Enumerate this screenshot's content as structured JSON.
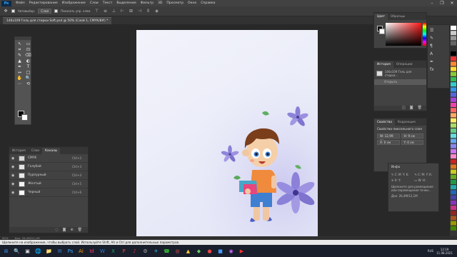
{
  "menubar": {
    "logo": "Ps",
    "items": [
      "Файл",
      "Редактирование",
      "Изображение",
      "Слои",
      "Текст",
      "Выделение",
      "Фильтр",
      "3D",
      "Просмотр",
      "Окно",
      "Справка"
    ],
    "window_buttons": [
      "–",
      "❐",
      "✕"
    ]
  },
  "options": {
    "autoselect_label": "Автовыбор:",
    "autoselect_value": "Слой",
    "transform_label": "Показать упр. элем."
  },
  "document": {
    "tab_title": "146х109 Гель для стирки Soft.psd @ 50% (Слой 1, CMYK/8#) *",
    "zoom": "50%",
    "doc_info": "Док: 26,4M/12,1M"
  },
  "tools": [
    "↖",
    "▭",
    "⌗",
    "⊡",
    "✎",
    "⌫",
    "▲",
    "◐",
    "✒",
    "T",
    "↔",
    "□",
    "✋",
    "🔍",
    "⋯",
    "⟲"
  ],
  "layers_panel": {
    "tabs": [
      "История",
      "Слои",
      "Каналы"
    ],
    "active_tab": "Каналы",
    "rows": [
      {
        "name": "CMYK",
        "shortcut": "Ctrl+2",
        "color": "#d8d8d8"
      },
      {
        "name": "Голубой",
        "shortcut": "Ctrl+3",
        "color": "#e4e4e4"
      },
      {
        "name": "Пурпурный",
        "shortcut": "Ctrl+4",
        "color": "#eaeaea"
      },
      {
        "name": "Желтый",
        "shortcut": "Ctrl+5",
        "color": "#f2f2f2"
      },
      {
        "name": "Черный",
        "shortcut": "Ctrl+6",
        "color": "#fafafa"
      }
    ]
  },
  "color_panel": {
    "tabs": [
      "Цвет",
      "Образцы"
    ]
  },
  "history_panel": {
    "tabs": [
      "История",
      "Операции"
    ],
    "items": [
      "146х109 Гель для стирки...",
      "Открыть"
    ]
  },
  "properties_panel": {
    "tabs": [
      "Свойства",
      "Коррекция"
    ],
    "title": "Свойства пиксельного слоя",
    "fields": [
      "W: 12,99 см",
      "H: 9 см",
      "X: 0 см",
      "Y: 0 см"
    ]
  },
  "info_panel": {
    "title": "Инфо",
    "note": "Щелкните для размещения или перемещения точки...",
    "doc_info": "Док: 26,4M/12,1M"
  },
  "tipbar": {
    "text": "Щелкните на изображение, чтобы выбрать слой. Используйте Shift, Alt и Ctrl для дополнительных параметров."
  },
  "taskbar": {
    "icons": [
      "⊞",
      "🔍",
      "▣",
      "🌐",
      "📁",
      "✉",
      "Ps",
      "Ai",
      "Id",
      "W",
      "X",
      "P",
      "♪",
      "⚙",
      "✈",
      "☎",
      "◎",
      "▲",
      "◆",
      "●",
      "■",
      "◉",
      "▶"
    ],
    "icon_colors": [
      "#3a8ee6",
      "#ddd",
      "#ddd",
      "#3a8ee6",
      "#f2c12e",
      "#3a8ee6",
      "#31a8ff",
      "#ff9a00",
      "#ff3366",
      "#2b7cd3",
      "#21a366",
      "#d35230",
      "#e33",
      "#aaa",
      "#2aa1d8",
      "#3c3",
      "#f55",
      "#fc3",
      "#6c6",
      "#e44",
      "#49f",
      "#c6f",
      "#f33"
    ],
    "lang": "RUS",
    "time": "12:19",
    "date": "11.08.2021"
  },
  "illustration": {
    "figures": [
      "boy-character",
      "purple-flowers",
      "green-leaves"
    ]
  }
}
